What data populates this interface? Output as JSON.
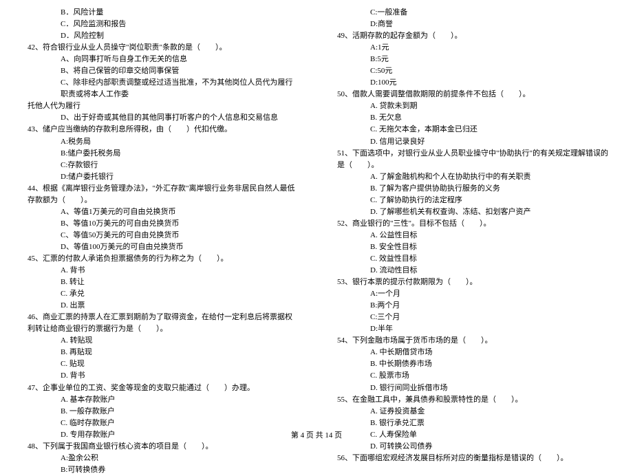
{
  "left": {
    "pre": [
      "B．风险计量",
      "C．风险监测和报告",
      "D．风险控制"
    ],
    "q42": {
      "stem": "42、符合银行业从业人员操守\"岗位职责\"条款的是（　　）。",
      "opts": [
        "A、向同事打听与自身工作无关的信息",
        "B、将自己保管的印章交给同事保管",
        "C、除非经内部职责调整或经过适当批准，不为其他岗位人员代为履行职责或将本人工作委",
        "D、出于好奇或其他目的其他同事打听客户的个人信息和交易信息"
      ],
      "cont2": "托他人代为履行"
    },
    "q43": {
      "stem": "43、储户应当缴纳的存款利息所得税，由（　　）代扣代缴。",
      "opts": [
        "A:税务局",
        "B:储户委托税务局",
        "C:存款银行",
        "D:储户委托银行"
      ]
    },
    "q44": {
      "stem": "44、根据《离岸银行业务管理办法》，\"外汇存款\"离岸银行业务非居民自然人最低存款额为（　　）。",
      "opts": [
        "A、等值1万美元的可自由兑换货币",
        "B、等值10万美元的可自由兑换货币",
        "C、等值50万美元的可自由兑换货币",
        "D、等值100万美元的可自由兑换货币"
      ]
    },
    "q45": {
      "stem": "45、汇票的付款人承诺负担票据债务的行为称之为（　　）。",
      "opts": [
        "A. 背书",
        "B. 转让",
        "C. 承兑",
        "D. 出票"
      ]
    },
    "q46": {
      "stem": "46、商业汇票的持票人在汇票到期前为了取得资金，在给付一定利息后将票据权利转让给商业银行的票据行为是（　　）。",
      "opts": [
        "A. 转贴现",
        "B. 再贴现",
        "C. 贴现",
        "D. 背书"
      ]
    },
    "q47": {
      "stem": "47、企事业单位的工资、奖金等现金的支取只能通过（　　）办理。",
      "opts": [
        "A. 基本存款账户",
        "B. 一般存款账户",
        "C. 临时存款账户",
        "D. 专用存款账户"
      ]
    },
    "q48": {
      "stem": "48、下列属于我国商业银行核心资本的项目是（　　）。",
      "opts": [
        "A:盈余公积",
        "B:可转换债券"
      ]
    }
  },
  "right": {
    "q48c": [
      "C:一般准备",
      "D:商誉"
    ],
    "q49": {
      "stem": "49、活期存款的起存金额为（　　）。",
      "opts": [
        "A:1元",
        "B:5元",
        "C:50元",
        "D:100元"
      ]
    },
    "q50": {
      "stem": "50、借款人需要调整借款期限的前提条件不包括（　　）。",
      "opts": [
        "A. 贷款未到期",
        "B. 无欠息",
        "C. 无拖欠本金，本期本金已归还",
        "D. 信用记录良好"
      ]
    },
    "q51": {
      "stem": "51、下面选项中，对银行业从业人员职业操守中\"协助执行\"的有关规定理解错误的是（　　）。",
      "opts": [
        "A. 了解金融机构和个人在协助执行中的有关职责",
        "B. 了解为客户提供协助执行服务的义务",
        "C. 了解协助执行的法定程序",
        "D. 了解哪些机关有权查询、冻结、扣划客户资产"
      ]
    },
    "q52": {
      "stem": "52、商业银行的\"三性\"。目标不包括（　　）。",
      "opts": [
        "A. 公益性目标",
        "B. 安全性目标",
        "C. 效益性目标",
        "D. 流动性目标"
      ]
    },
    "q53": {
      "stem": "53、银行本票的提示付款期限为（　　）。",
      "opts": [
        "A:一个月",
        "B:两个月",
        "C:三个月",
        "D:半年"
      ]
    },
    "q54": {
      "stem": "54、下列金融市场属于货币市场的是（　　）。",
      "opts": [
        "A. 中长期借贷市场",
        "B. 中长期债券市场",
        "C. 股票市场",
        "D. 银行间同业拆借市场"
      ]
    },
    "q55": {
      "stem": "55、在金融工具中，兼具债券和股票特性的是（　　）。",
      "opts": [
        "A. 证券投资基金",
        "B. 银行承兑汇票",
        "C. 人寿保险单",
        "D. 可转换公司债券"
      ]
    },
    "q56": {
      "stem": "56、下面哪组宏观经济发展目标所对应的衡量指标是错误的（　　）。"
    }
  },
  "footer": "第 4 页 共 14 页"
}
